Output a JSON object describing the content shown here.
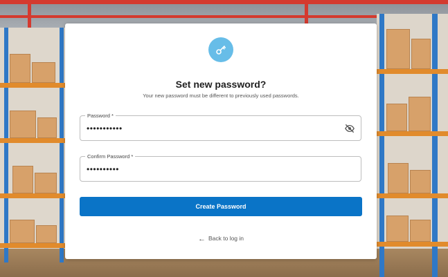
{
  "card": {
    "icon": "key-icon",
    "title": "Set new password?",
    "subtitle": "Your new password must be different to previously used passwords."
  },
  "form": {
    "password": {
      "label": "Password *",
      "value": "•••••••••••",
      "toggle_icon": "eye-off-icon"
    },
    "confirm_password": {
      "label": "Confirm Password *",
      "value": "••••••••••"
    },
    "submit_label": "Create Password"
  },
  "footer": {
    "back_icon": "arrow-left-icon",
    "back_label": "Back to log in"
  },
  "colors": {
    "primary": "#0a74c7",
    "icon_badge": "#67bde8",
    "background_accent": "#d43a2f"
  }
}
